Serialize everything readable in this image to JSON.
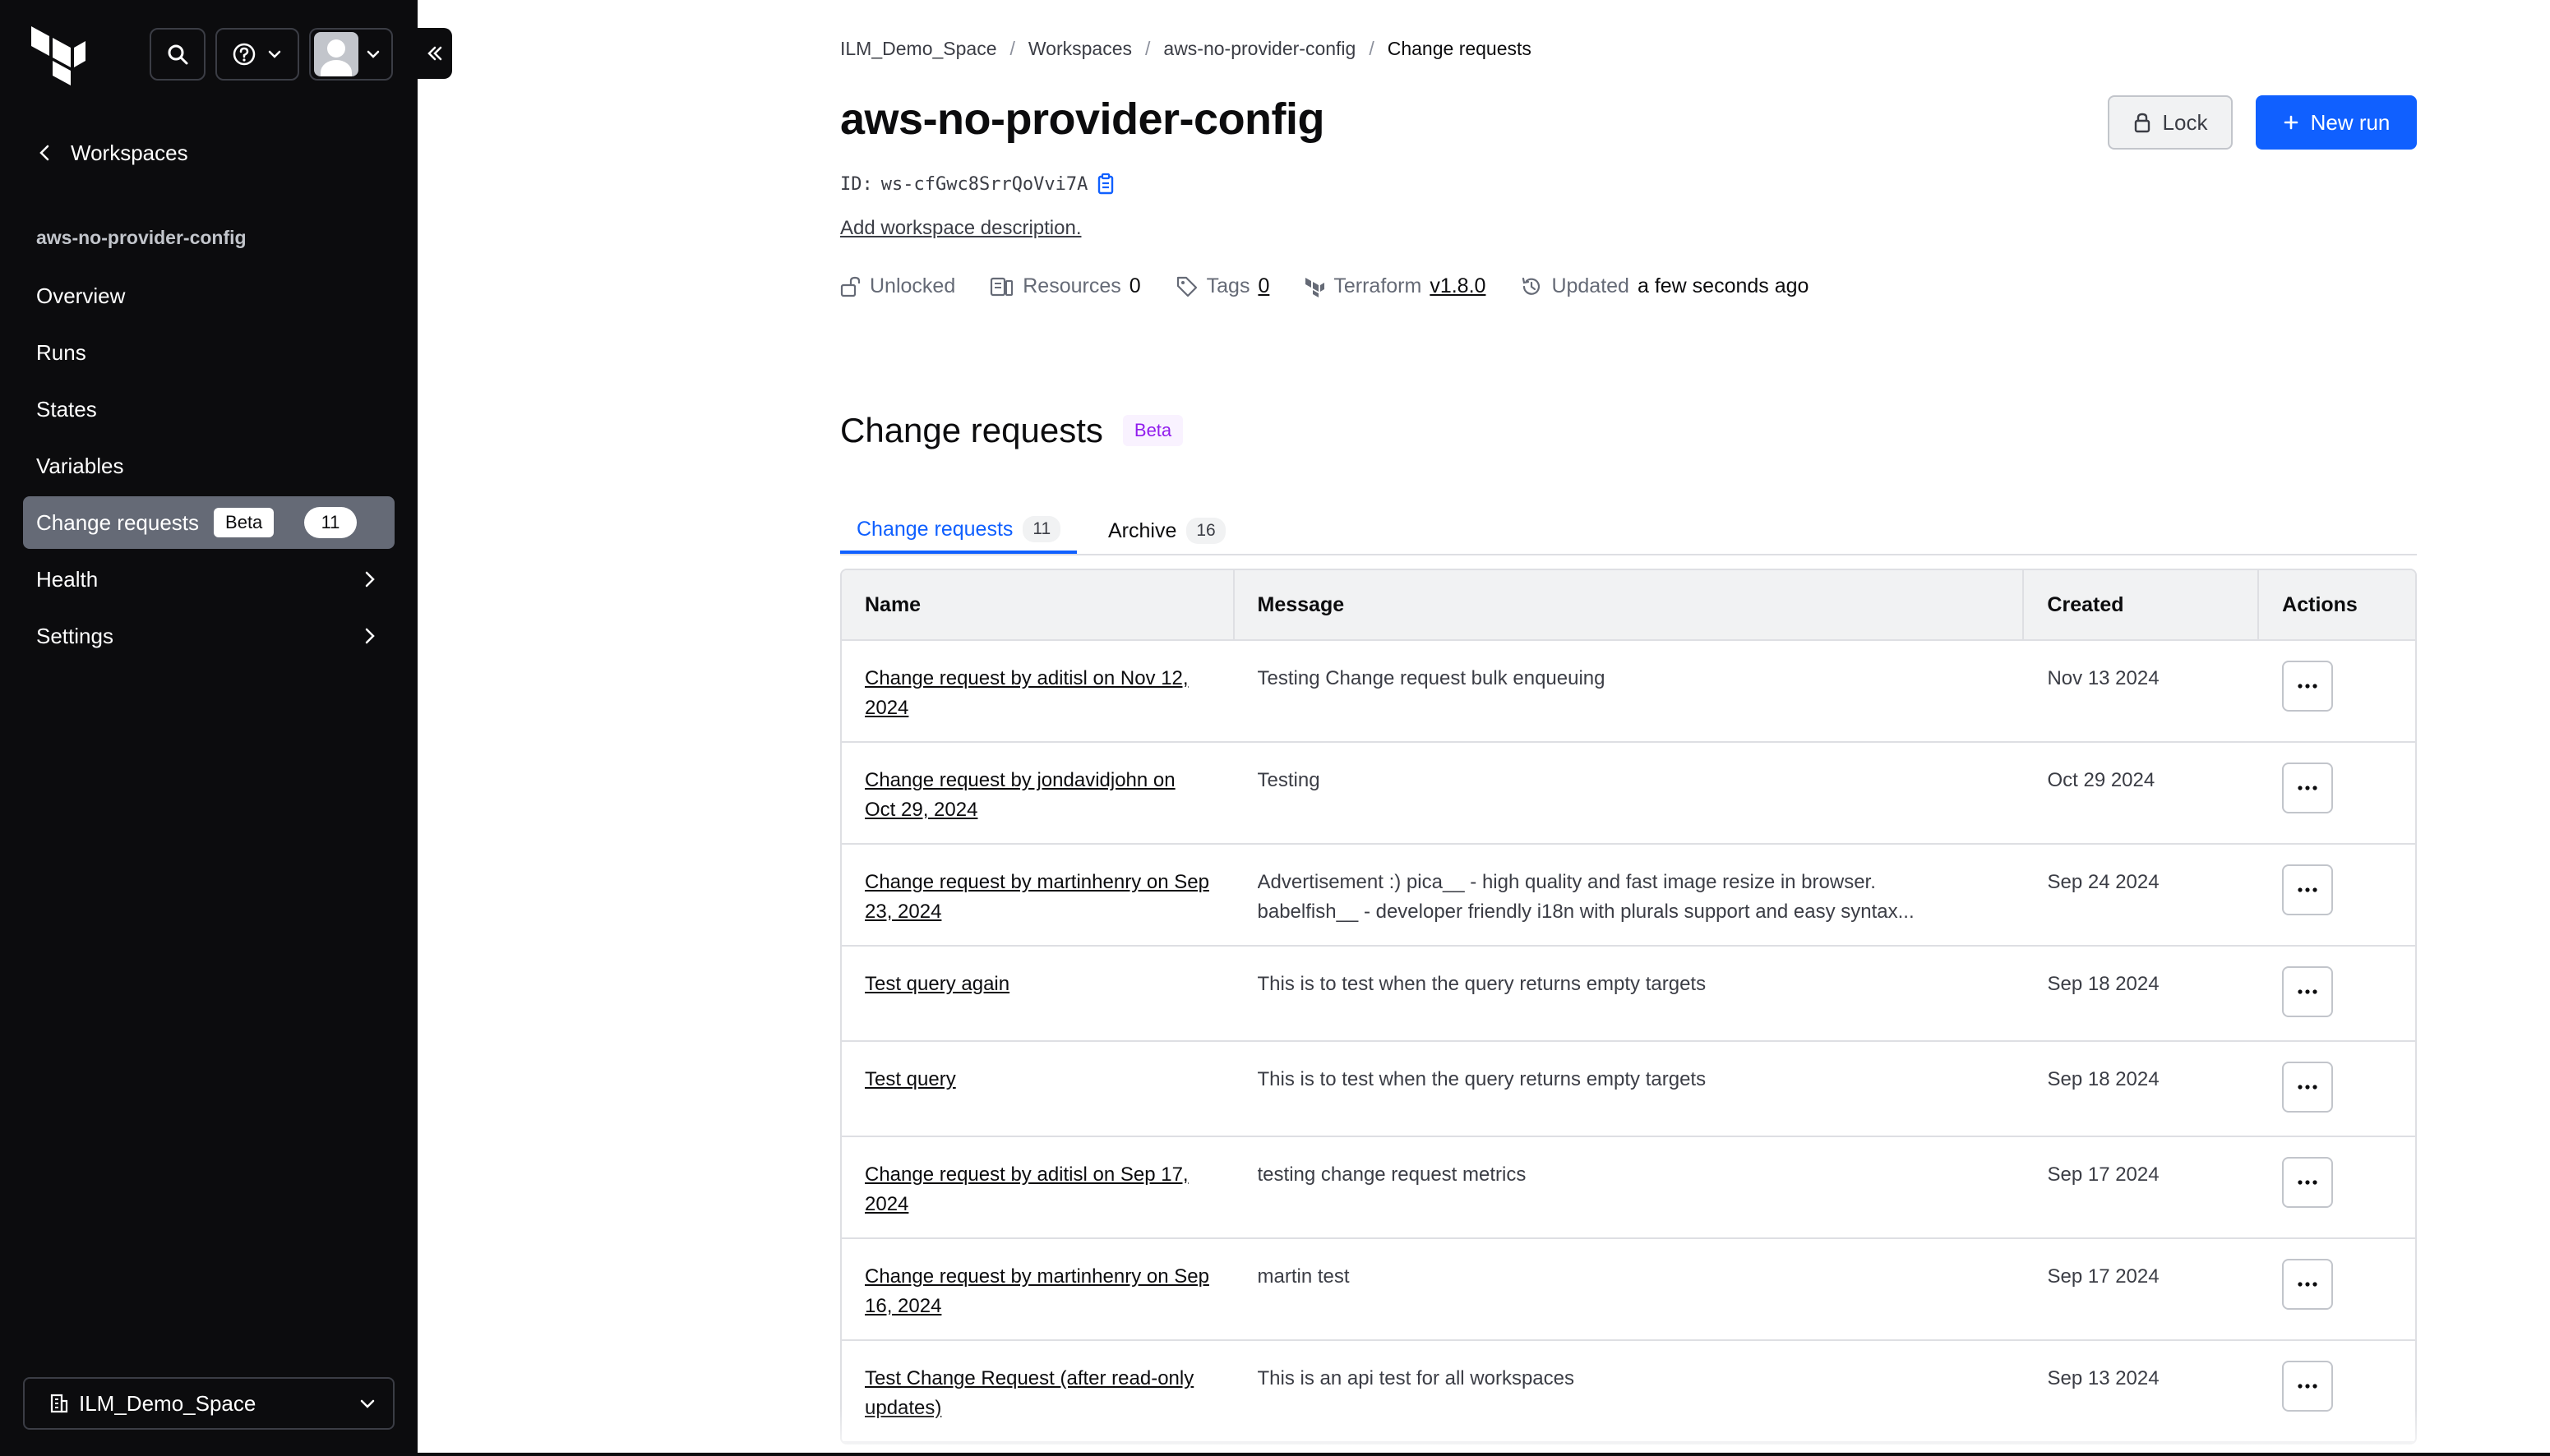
{
  "sidebar": {
    "back_label": "Workspaces",
    "workspace_name": "aws-no-provider-config",
    "items": [
      {
        "label": "Overview"
      },
      {
        "label": "Runs"
      },
      {
        "label": "States"
      },
      {
        "label": "Variables"
      },
      {
        "label": "Change requests",
        "badge": "Beta",
        "count": "11"
      },
      {
        "label": "Health"
      },
      {
        "label": "Settings"
      }
    ],
    "org_label": "ILM_Demo_Space"
  },
  "breadcrumb": [
    "ILM_Demo_Space",
    "Workspaces",
    "aws-no-provider-config",
    "Change requests"
  ],
  "header": {
    "title": "aws-no-provider-config",
    "id_label": "ID:",
    "id_value": "ws-cfGwc8SrrQoVvi7A",
    "description_link": "Add workspace description.",
    "lock_label": "Lock",
    "new_run_label": "New run"
  },
  "meta": {
    "lock_status": "Unlocked",
    "resources_label": "Resources",
    "resources_count": "0",
    "tags_label": "Tags",
    "tags_count": "0",
    "terraform_label": "Terraform",
    "terraform_version": "v1.8.0",
    "updated_label": "Updated",
    "updated_value": "a few seconds ago"
  },
  "section": {
    "title": "Change requests",
    "badge": "Beta"
  },
  "tabs": [
    {
      "label": "Change requests",
      "count": "11"
    },
    {
      "label": "Archive",
      "count": "16"
    }
  ],
  "table": {
    "columns": [
      "Name",
      "Message",
      "Created",
      "Actions"
    ],
    "rows": [
      {
        "name": "Change request by aditisl on Nov 12, 2024",
        "message": [
          "Testing Change request bulk enqueuing"
        ],
        "created": "Nov 13 2024"
      },
      {
        "name": "Change request by jondavidjohn on Oct 29, 2024",
        "message": [
          "Testing"
        ],
        "created": "Oct 29 2024"
      },
      {
        "name": "Change request by martinhenry on Sep 23, 2024",
        "message": [
          "Advertisement :) pica__ - high quality and fast image resize in browser.",
          "babelfish__ - developer friendly i18n with plurals support and easy syntax..."
        ],
        "created": "Sep 24 2024"
      },
      {
        "name": "Test query again",
        "message": [
          "This is to test when the query returns empty targets"
        ],
        "created": "Sep 18 2024"
      },
      {
        "name": "Test query",
        "message": [
          "This is to test when the query returns empty targets"
        ],
        "created": "Sep 18 2024"
      },
      {
        "name": "Change request by aditisl on Sep 17, 2024",
        "message": [
          "testing change request metrics"
        ],
        "created": "Sep 17 2024"
      },
      {
        "name": "Change request by martinhenry on Sep 16, 2024",
        "message": [
          "martin test"
        ],
        "created": "Sep 17 2024"
      },
      {
        "name": "Test Change Request (after read-only updates)",
        "message": [
          "This is an api test for all workspaces"
        ],
        "created": "Sep 13 2024"
      }
    ]
  },
  "colors": {
    "sidebar_bg": "#0c0c0e",
    "accent": "#1060ff",
    "active_nav": "#656a76",
    "beta_text": "#911ced",
    "beta_bg": "#f9f2ff"
  }
}
